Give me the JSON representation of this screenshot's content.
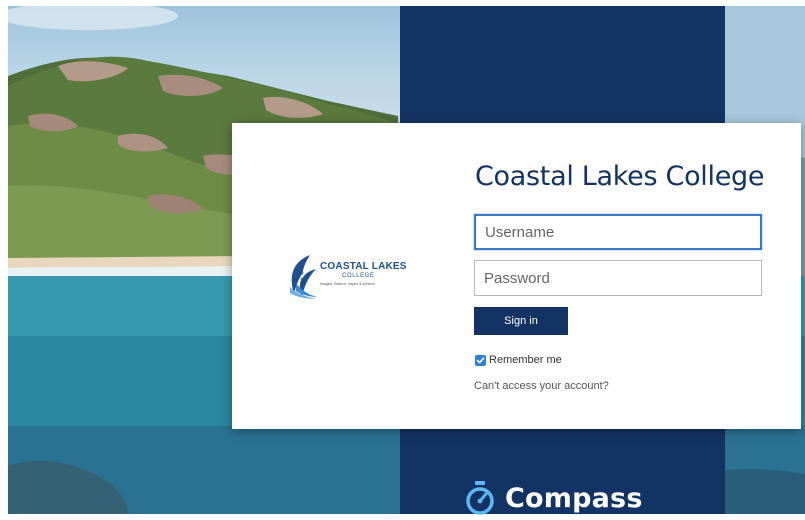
{
  "login": {
    "title": "Coastal Lakes College",
    "username_placeholder": "Username",
    "password_placeholder": "Password",
    "signin_label": "Sign in",
    "remember_label": "Remember me",
    "remember_checked": true,
    "cant_access_label": "Can't access your account?"
  },
  "school_logo": {
    "name_main": "COASTAL LAKES",
    "name_sub": "COLLEGE",
    "motto": "Imagine, Believe, Inspire & Achieve"
  },
  "brand": {
    "product_name": "Compass",
    "icon": "compass-timer-icon"
  },
  "colors": {
    "navy": "#143365",
    "focus_blue": "#3c78c8",
    "checkbox_blue": "#2f7fd6"
  }
}
